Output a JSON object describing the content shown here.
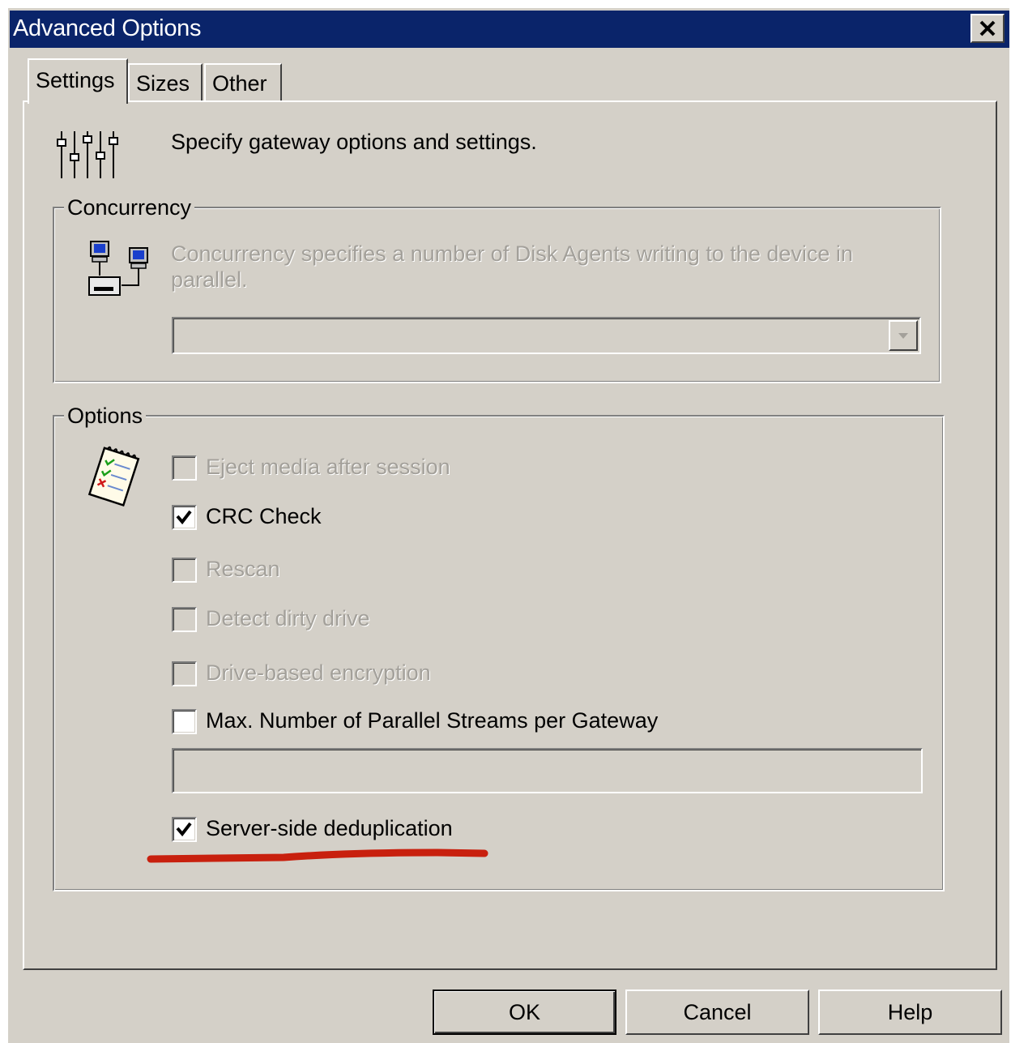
{
  "window": {
    "title": "Advanced Options",
    "close_icon": "close-icon"
  },
  "tabs": [
    {
      "label": "Settings",
      "active": true
    },
    {
      "label": "Sizes",
      "active": false
    },
    {
      "label": "Other",
      "active": false
    }
  ],
  "header": {
    "icon": "sliders-icon",
    "description": "Specify gateway options and settings."
  },
  "concurrency": {
    "legend": "Concurrency",
    "icon": "network-computers-icon",
    "description_line1": "Concurrency specifies a number of Disk Agents writing to the device in",
    "description_line2": "parallel.",
    "select_value": ""
  },
  "options": {
    "legend": "Options",
    "icon": "checklist-icon",
    "items": [
      {
        "label": "Eject media after session",
        "checked": false,
        "enabled": false
      },
      {
        "label": "CRC Check",
        "checked": true,
        "enabled": true
      },
      {
        "label": "Rescan",
        "checked": false,
        "enabled": false
      },
      {
        "label": "Detect dirty drive",
        "checked": false,
        "enabled": false
      },
      {
        "label": "Drive-based encryption",
        "checked": false,
        "enabled": false
      },
      {
        "label": "Max. Number of Parallel Streams per Gateway",
        "checked": false,
        "enabled": true
      },
      {
        "label": "Server-side deduplication",
        "checked": true,
        "enabled": true
      }
    ],
    "parallel_streams_value": ""
  },
  "annotation": {
    "color": "#c8200e"
  },
  "buttons": {
    "ok": "OK",
    "cancel": "Cancel",
    "help": "Help"
  }
}
